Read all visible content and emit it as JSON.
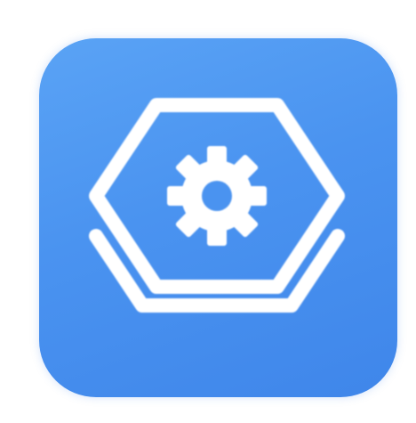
{
  "app_icon": {
    "icon": "hexagon-gear-settings-icon",
    "tile_color": "#4a93f0",
    "glyph_color": "#ffffff"
  }
}
